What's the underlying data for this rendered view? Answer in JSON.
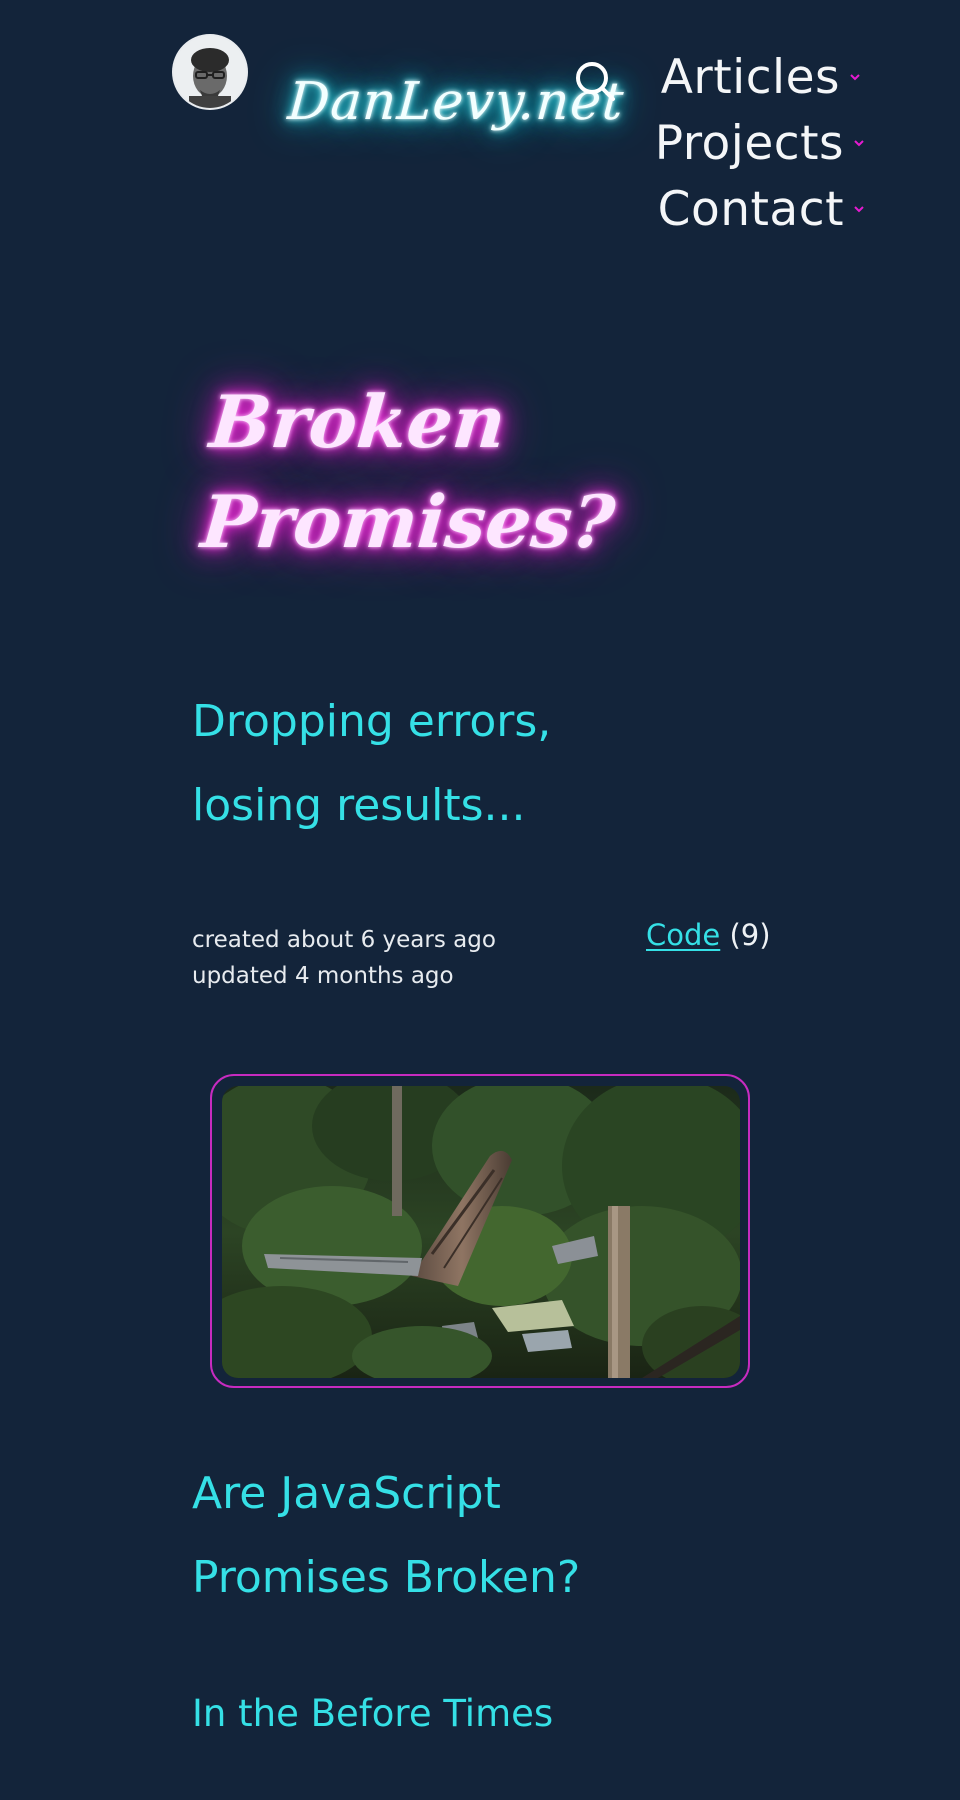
{
  "site": {
    "logo": "DanLevy.net",
    "accent_cyan": "#35e0e6",
    "accent_magenta": "#e51bd0",
    "background": "#13243a"
  },
  "header": {
    "avatar_icon": "avatar-photo",
    "search_icon": "search-icon",
    "nav": [
      {
        "label": "Articles",
        "icon": "chevron-down-icon"
      },
      {
        "label": "Projects",
        "icon": "chevron-down-icon"
      },
      {
        "label": "Contact",
        "icon": "chevron-down-icon"
      }
    ]
  },
  "post": {
    "title_lines": [
      "Broken",
      "Promises?"
    ],
    "subtitle_lines": [
      "Dropping errors,",
      "losing results..."
    ],
    "created": "created about 6 years ago",
    "updated": "updated 4 months ago",
    "category": {
      "label": "Code",
      "count": "(9)"
    },
    "article_heading_lines": [
      "Are JavaScript",
      "Promises Broken?"
    ],
    "section_heading": "In the Before Times"
  }
}
